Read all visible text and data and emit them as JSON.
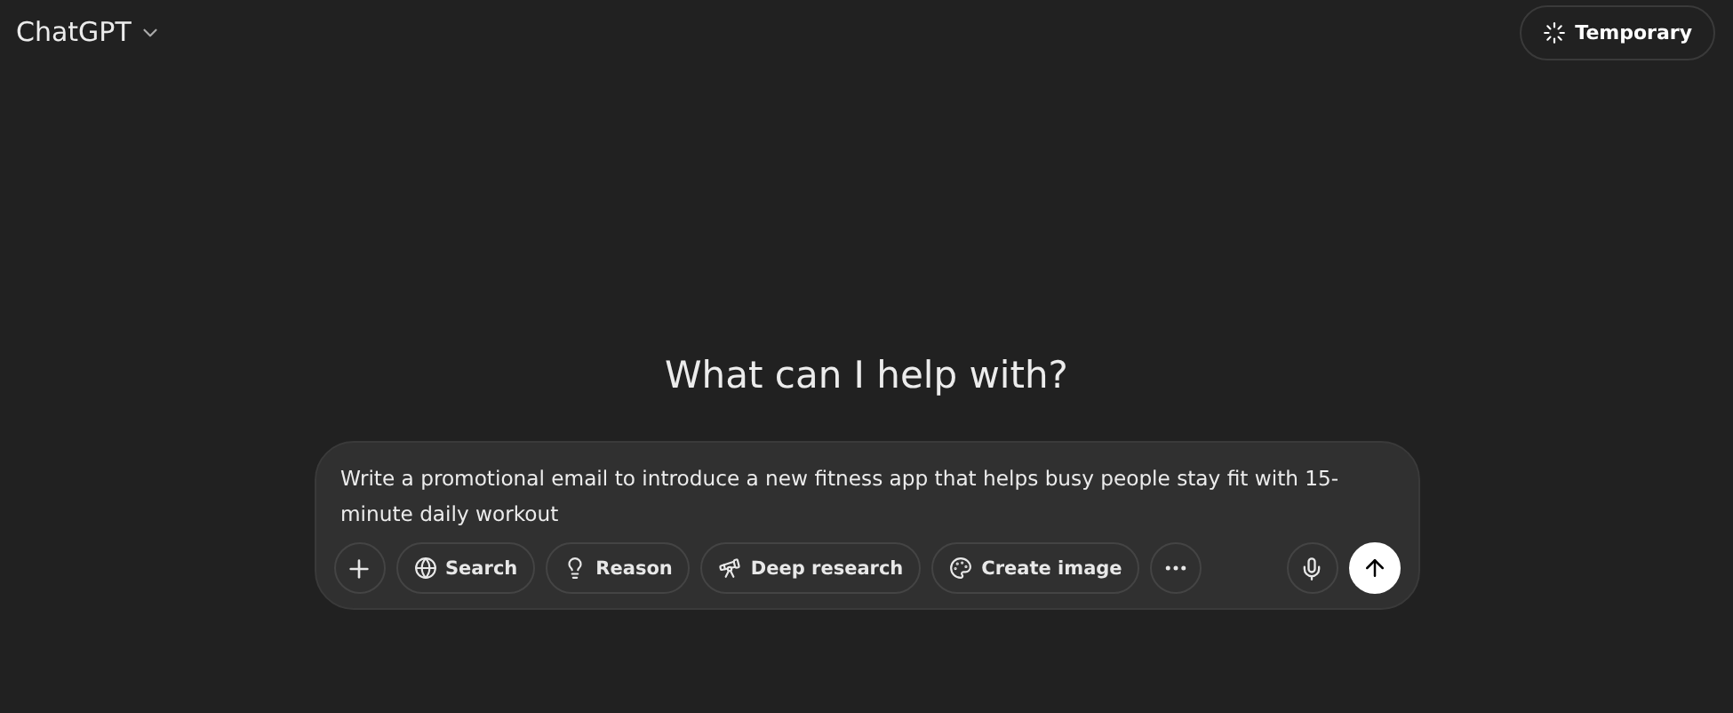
{
  "header": {
    "model": "ChatGPT",
    "temporary_button": "Temporary"
  },
  "heading": "What can I help with?",
  "composer": {
    "value": "Write a promotional email to introduce a new fitness app that helps busy people stay fit with 15-minute daily workout",
    "tools": [
      {
        "kind": "globe",
        "label": "Search"
      },
      {
        "kind": "bulb",
        "label": "Reason"
      },
      {
        "kind": "telescope",
        "label": "Deep research"
      },
      {
        "kind": "palette",
        "label": "Create image"
      }
    ]
  }
}
